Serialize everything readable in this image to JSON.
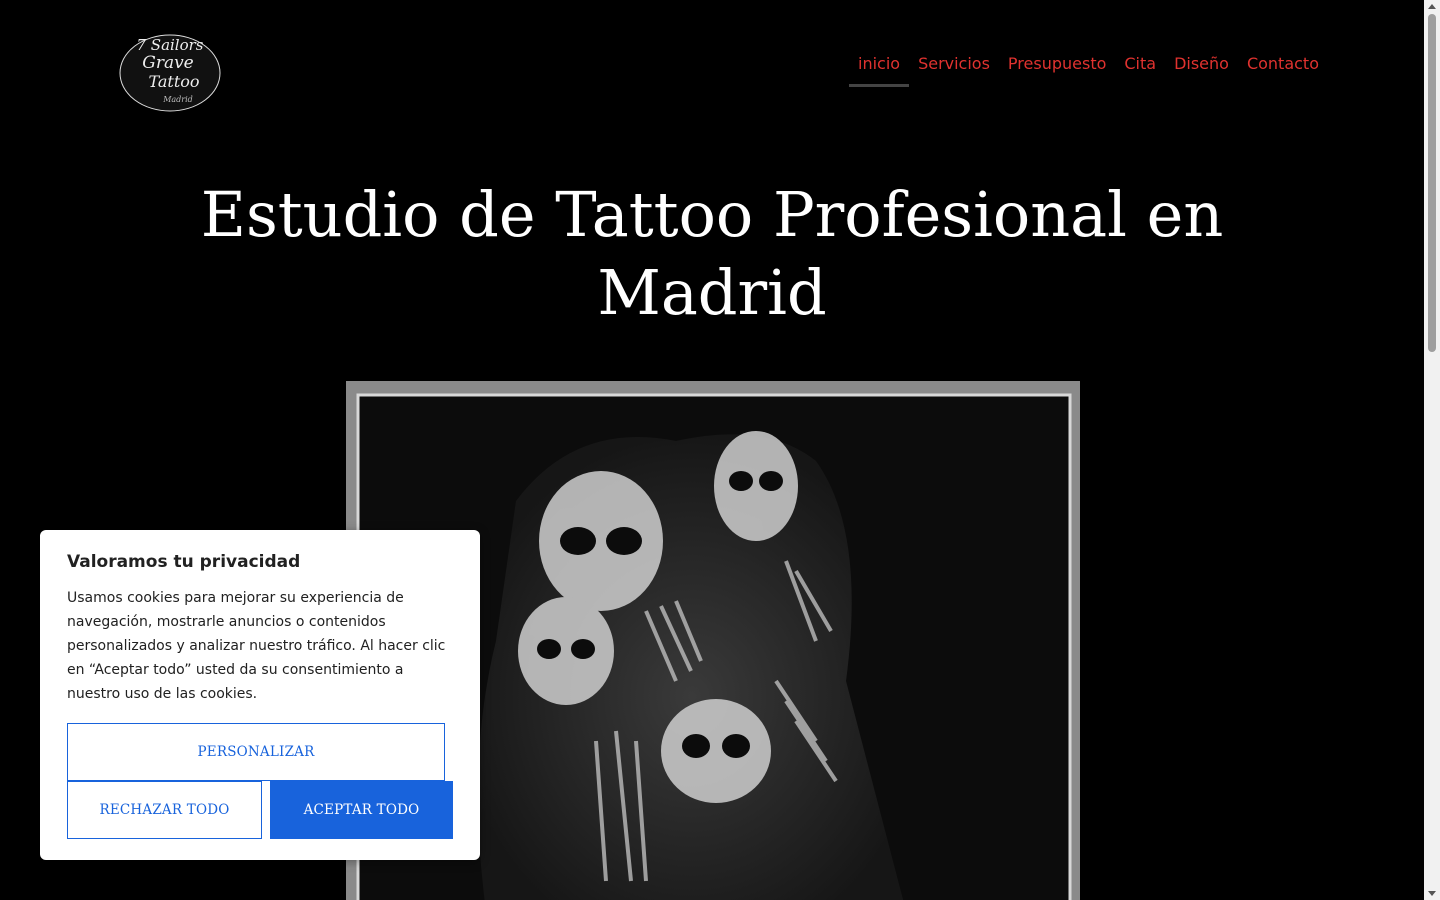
{
  "header": {
    "logo_text": [
      "7 Sailors",
      "Grave",
      "Tattoo",
      "Madrid"
    ],
    "nav": [
      {
        "label": "inicio",
        "active": true
      },
      {
        "label": "Servicios",
        "active": false
      },
      {
        "label": "Presupuesto",
        "active": false
      },
      {
        "label": "Cita",
        "active": false
      },
      {
        "label": "Diseño",
        "active": false
      },
      {
        "label": "Contacto",
        "active": false
      }
    ]
  },
  "hero": {
    "title_line1": "Estudio de Tattoo Profesional en",
    "title_line2": "Madrid"
  },
  "cookie_banner": {
    "title": "Valoramos tu privacidad",
    "body": "Usamos cookies para mejorar su experiencia de navegación, mostrarle anuncios o contenidos personalizados y analizar nuestro tráfico. Al hacer clic en “Aceptar todo” usted da su consentimiento a nuestro uso de las cookies.",
    "customize_label": "PERSONALIZAR",
    "reject_label": "RECHAZAR TODO",
    "accept_label": "ACEPTAR TODO"
  },
  "colors": {
    "nav_link": "#e0322f",
    "accent_blue": "#1863dc",
    "background": "#000000"
  }
}
